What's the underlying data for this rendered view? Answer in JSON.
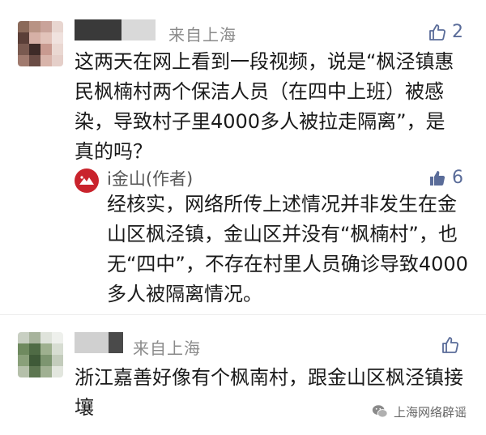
{
  "comments": [
    {
      "location": "来自上海",
      "likes": "2",
      "text": "这两天在网上看到一段视频，说是“枫泾镇惠民枫楠村两个保洁人员（在四中上班）被感染，导致村子里4000多人被拉走隔离”，是真的吗？"
    },
    {
      "location": "来自上海",
      "likes": "",
      "text": "浙江嘉善好像有个枫南村，跟金山区枫泾镇接壤"
    }
  ],
  "reply": {
    "name": "i金山(作者)",
    "likes": "6",
    "text": "经核实，网络所传上述情况并非发生在金山区枫泾镇，金山区并没有“枫楠村”，也无“四中”，不存在村里人员确诊导致4000多人被隔离情况。"
  },
  "watermark": {
    "label": "上海网络辟谣"
  },
  "colors": {
    "like_outline": "#5a6c99",
    "like_filled": "#5a6c99",
    "author_logo": "#c9232c"
  }
}
